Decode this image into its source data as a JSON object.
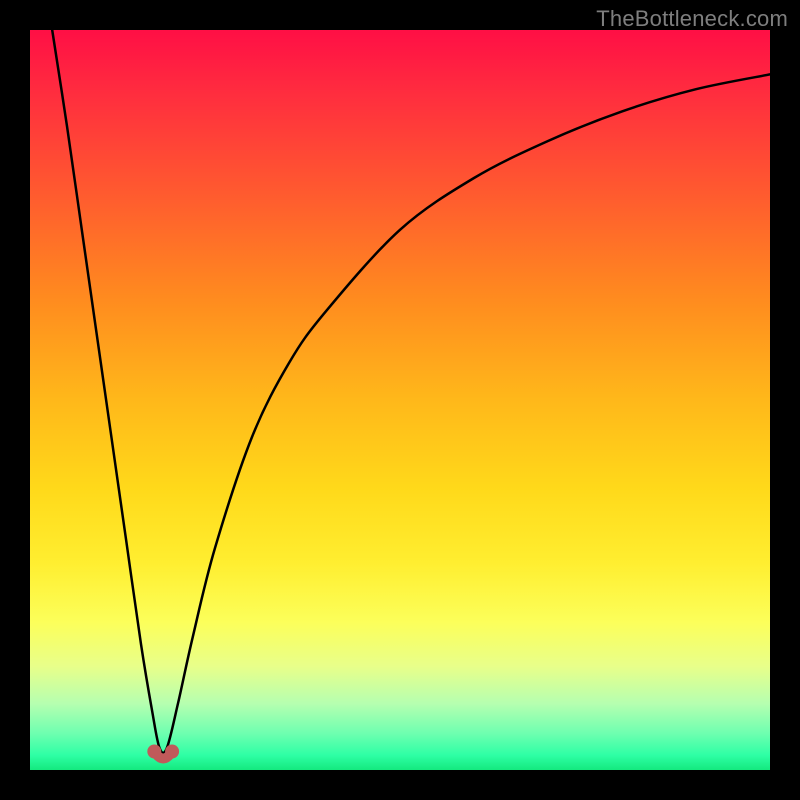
{
  "watermark": "TheBottleneck.com",
  "chart_data": {
    "type": "line",
    "title": "",
    "xlabel": "",
    "ylabel": "",
    "xlim": [
      0,
      100
    ],
    "ylim": [
      0,
      100
    ],
    "grid": false,
    "legend": false,
    "colors": {
      "gradient_top": "#ff0f45",
      "gradient_mid": "#ffd91a",
      "gradient_bottom": "#14e97e",
      "curve": "#000000",
      "marker": "#c05a5a"
    },
    "curve_minimum_x": 18,
    "series": [
      {
        "name": "bottleneck-curve",
        "x": [
          3,
          5,
          7,
          9,
          11,
          13,
          15,
          16.5,
          17.5,
          18.5,
          20,
          22,
          25,
          30,
          35,
          40,
          50,
          60,
          70,
          80,
          90,
          100
        ],
        "y": [
          100,
          87,
          73,
          59,
          45,
          31,
          17,
          8,
          3,
          3,
          9,
          18,
          30,
          45,
          55,
          62,
          73,
          80,
          85,
          89,
          92,
          94
        ]
      }
    ],
    "markers": [
      {
        "x": 16.8,
        "y": 2.5
      },
      {
        "x": 19.2,
        "y": 2.5
      }
    ],
    "annotations": []
  }
}
